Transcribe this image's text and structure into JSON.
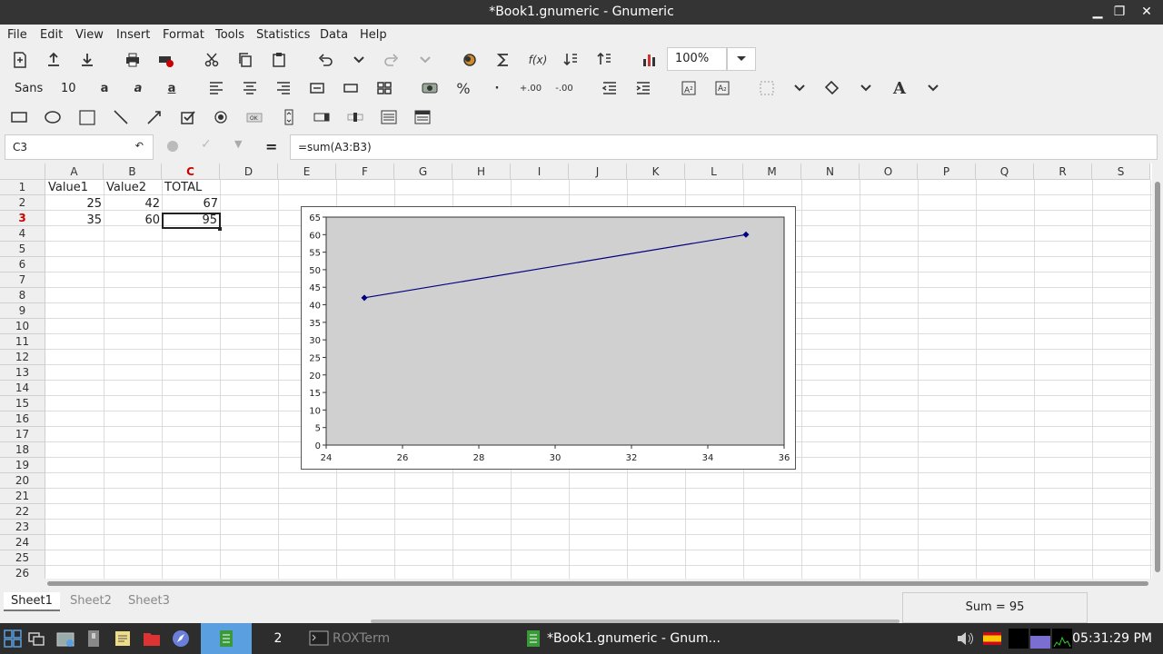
{
  "window": {
    "title": "*Book1.gnumeric - Gnumeric",
    "minimize": "▁",
    "maximize": "❐",
    "close": "✕"
  },
  "menu": [
    "File",
    "Edit",
    "View",
    "Insert",
    "Format",
    "Tools",
    "Statistics",
    "Data",
    "Help"
  ],
  "toolbar": {
    "zoom": "100%",
    "font_name": "Sans",
    "font_size": "10",
    "icons": [
      "new-file-icon",
      "open-icon",
      "save-icon",
      "print-icon",
      "print-preview-icon",
      "cut-icon",
      "copy-icon",
      "paste-icon",
      "undo-icon",
      "undo-dropdown-icon",
      "redo-icon",
      "redo-dropdown-icon",
      "hyperlink-icon",
      "autosum-icon",
      "function-icon",
      "sort-ascending-icon",
      "sort-descending-icon",
      "chart-icon"
    ]
  },
  "formula_bar": {
    "cell_ref": "C3",
    "formula": "=sum(A3:B3)",
    "equals": "="
  },
  "sheet": {
    "columns": [
      "A",
      "B",
      "C",
      "D",
      "E",
      "F",
      "G",
      "H",
      "I",
      "J",
      "K",
      "L",
      "M",
      "N",
      "O",
      "P",
      "Q",
      "R",
      "S"
    ],
    "rows": [
      "1",
      "2",
      "3",
      "4",
      "5",
      "6",
      "7",
      "8",
      "9",
      "10",
      "11",
      "12",
      "13",
      "14",
      "15",
      "16",
      "17",
      "18",
      "19",
      "20",
      "21",
      "22",
      "23",
      "24",
      "25",
      "26"
    ],
    "cells": {
      "A1": "Value1",
      "B1": "Value2",
      "C1": "TOTAL",
      "A2": "25",
      "B2": "42",
      "C2": "67",
      "A3": "35",
      "B3": "60",
      "C3": "95"
    },
    "active_cell": "C3",
    "active_row": "3",
    "active_col": "C"
  },
  "chart_data": {
    "type": "line",
    "x": [
      25,
      35
    ],
    "series": [
      {
        "values": [
          42,
          60
        ],
        "color": "#000080"
      }
    ],
    "xlim": [
      24,
      36
    ],
    "ylim": [
      0,
      65
    ],
    "xticks": [
      "24",
      "26",
      "28",
      "30",
      "32",
      "34",
      "36"
    ],
    "yticks": [
      "0",
      "5",
      "10",
      "15",
      "20",
      "25",
      "30",
      "35",
      "40",
      "45",
      "50",
      "55",
      "60",
      "65"
    ],
    "plot_background": "#d0d0d0"
  },
  "sheet_tabs": [
    "Sheet1",
    "Sheet2",
    "Sheet3"
  ],
  "status": {
    "sum": "Sum = 95"
  },
  "taskbar": {
    "workspace": "2",
    "roxterm": "ROXTerm",
    "active_window": "*Book1.gnumeric - Gnum...",
    "clock": "05:31:29 PM"
  },
  "colors": {
    "active_header": "#cc0000",
    "titlebar": "#343434",
    "taskbar": "#2d2d2d",
    "taskbar_active": "#5aa0e0"
  }
}
